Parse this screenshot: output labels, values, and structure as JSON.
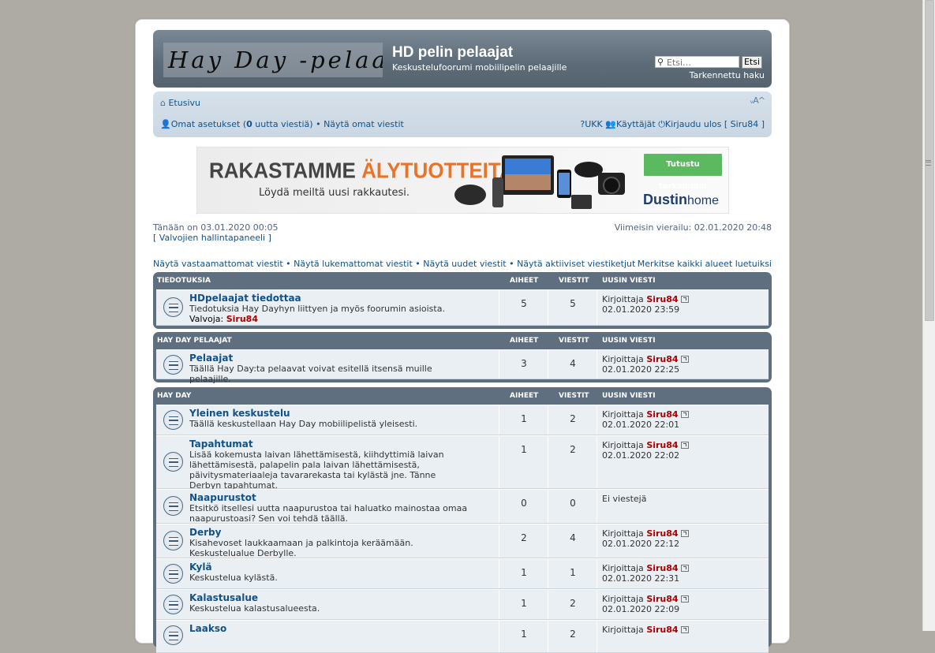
{
  "header": {
    "logo_text": "Hay Day -pelaajat",
    "site_title": "HD pelin pelaajat",
    "site_description": "Keskustelufoorumi mobiilipelin pelaajille",
    "search_placeholder": "Etsi…",
    "search_button": "Etsi",
    "advanced_search": "Tarkennettu haku"
  },
  "navbar": {
    "home": "Etusivu",
    "font_size": "ᵥA^",
    "user_settings": "Omat asetukset",
    "new_messages_prefix": "(",
    "new_messages_count": "0",
    "new_messages_suffix": "uutta viestiä)",
    "bullet": "•",
    "own_posts": "Näytä omat viestit",
    "faq": "UKK",
    "users": "Käyttäjät",
    "logout": "Kirjaudu ulos",
    "username": "[ Siru84 ]"
  },
  "banner": {
    "headline_a": "RAKASTAMME ",
    "headline_b": "ÄLYTUOTTEITA",
    "sub": "Löydä meiltä uusi rakkautesi.",
    "button": "Tutustu tarkemmin",
    "brand_a": "Dustin",
    "brand_b": "home"
  },
  "info": {
    "today": "Tänään on 03.01.2020 00:05",
    "mod_panel": "[ Valvojien hallintapaneeli ]",
    "last_visit": "Viimeisin vierailu: 02.01.2020 20:48"
  },
  "links": {
    "unanswered": "Näytä vastaamattomat viestit",
    "unread": "Näytä lukemattomat viestit",
    "new": "Näytä uudet viestit",
    "active": "Näytä aktiiviset viestiketjut",
    "bullet": "•",
    "mark_read": "Merkitse kaikki alueet luetuiksi"
  },
  "columns": {
    "topics": "AIHEET",
    "posts": "VIESTIT",
    "last": "UUSIN VIESTI"
  },
  "categories": [
    {
      "name": "TIEDOTUKSIA",
      "forums": [
        {
          "title": "HDpelaajat tiedottaa",
          "desc": "Tiedotuksia Hay Dayhyn liittyen ja myös foorumin asioista.",
          "mod_label": "Valvoja:",
          "mod_user": "Siru84",
          "topics": "5",
          "posts": "5",
          "by": "Kirjoittaja",
          "user": "Siru84",
          "date": "02.01.2020 23:59"
        }
      ]
    },
    {
      "name": "HAY DAY PELAAJAT",
      "forums": [
        {
          "title": "Pelaajat",
          "desc": "Täällä Hay Day:ta pelaavat voivat esitellä itsensä muille pelaajille.",
          "topics": "3",
          "posts": "4",
          "by": "Kirjoittaja",
          "user": "Siru84",
          "date": "02.01.2020 22:25"
        }
      ]
    },
    {
      "name": "HAY DAY",
      "forums": [
        {
          "title": "Yleinen keskustelu",
          "desc": "Täällä keskustellaan Hay Day mobiilipelistä yleisesti.",
          "topics": "1",
          "posts": "2",
          "by": "Kirjoittaja",
          "user": "Siru84",
          "date": "02.01.2020 22:01"
        },
        {
          "title": "Tapahtumat",
          "desc": "Lisää kokemusta laivan lähettämisestä, kiihdyttimiä laivan lähettämisestä, palapelin pala laivan lähettämisestä, päivitysmateriaaleja tavararekasta tai kylästä jne. Tänne Derbyn tapahtumat.",
          "topics": "1",
          "posts": "2",
          "by": "Kirjoittaja",
          "user": "Siru84",
          "date": "02.01.2020 22:02"
        },
        {
          "title": "Naapurustot",
          "desc": "Etsitkö itsellesi uutta naapurustoa tai haluatko mainostaa omaa naapurustoasi? Sen voi tehdä täällä.",
          "topics": "0",
          "posts": "0",
          "none": "Ei viestejä"
        },
        {
          "title": "Derby",
          "desc": "Kisahevoset laukkaamaan ja palkintoja keräämään. Keskustelualue Derbylle.",
          "topics": "2",
          "posts": "4",
          "by": "Kirjoittaja",
          "user": "Siru84",
          "date": "02.01.2020 22:12"
        },
        {
          "title": "Kylä",
          "desc": "Keskustelua kylästä.",
          "topics": "1",
          "posts": "1",
          "by": "Kirjoittaja",
          "user": "Siru84",
          "date": "02.01.2020 22:31"
        },
        {
          "title": "Kalastusalue",
          "desc": "Keskustelua kalastusalueesta.",
          "topics": "1",
          "posts": "2",
          "by": "Kirjoittaja",
          "user": "Siru84",
          "date": "02.01.2020 22:09"
        },
        {
          "title": "Laakso",
          "desc": "",
          "topics": "1",
          "posts": "2",
          "by": "Kirjoittaja",
          "user": "Siru84",
          "date": ""
        }
      ]
    }
  ]
}
